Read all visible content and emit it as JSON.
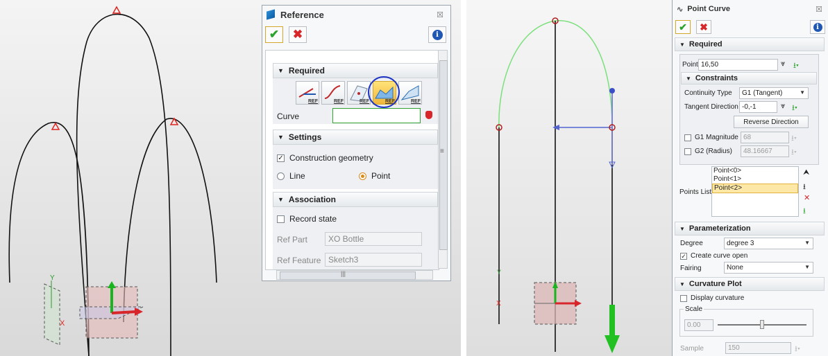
{
  "reference_panel": {
    "title": "Reference",
    "close_glyph": "☒",
    "ok_glyph": "✔",
    "cancel_glyph": "✖",
    "info_glyph": "i",
    "sections": {
      "required": {
        "label": "Required"
      },
      "settings": {
        "label": "Settings"
      },
      "association": {
        "label": "Association"
      }
    },
    "ref_icon_badge": "REF",
    "curve_label": "Curve",
    "construction_geometry": {
      "label": "Construction geometry",
      "checked": true
    },
    "mode_options": [
      {
        "label": "Line",
        "selected": false
      },
      {
        "label": "Point",
        "selected": true
      }
    ],
    "record_state": {
      "label": "Record state",
      "checked": false
    },
    "ref_part": {
      "label": "Ref Part",
      "value": "XO Bottle"
    },
    "ref_feature": {
      "label": "Ref Feature",
      "value": "Sketch3"
    },
    "scroll_grip": "|||",
    "scroll_side_grip": "≡"
  },
  "point_curve_panel": {
    "title": "Point Curve",
    "close_glyph": "☒",
    "sections": {
      "required": "Required",
      "constraints": "Constraints",
      "parameterization": "Parameterization",
      "curvature_plot": "Curvature Plot"
    },
    "point": {
      "label": "Point",
      "value": "16,50"
    },
    "continuity_type": {
      "label": "Continuity Type",
      "value": "G1 (Tangent)"
    },
    "tangent_direction": {
      "label": "Tangent Direction",
      "value": "-0,-1"
    },
    "reverse_direction": "Reverse Direction",
    "g1_magnitude": {
      "label": "G1 Magnitude",
      "value": "68"
    },
    "g2_radius": {
      "label": "G2 (Radius)",
      "value": "48.16667"
    },
    "points_list": {
      "label": "Points List",
      "items": [
        "Point<0>",
        "Point<1>",
        "Point<2>"
      ],
      "selected_index": 2
    },
    "degree": {
      "label": "Degree",
      "value": "degree 3"
    },
    "create_curve_open": {
      "label": "Create curve open",
      "checked": true
    },
    "fairing": {
      "label": "Fairing",
      "value": "None"
    },
    "display_curvature": {
      "label": "Display curvature",
      "checked": false
    },
    "scale": {
      "label": "Scale",
      "value": "0.00",
      "level": 0.5
    },
    "sample": {
      "label": "Sample",
      "value": "150"
    }
  },
  "colors": {
    "accent_blue": "#1f57b5",
    "ok_green": "#2ea12e",
    "cancel_red": "#d8252a",
    "selected_orange": "#d98b1c",
    "curve_green": "#7be07b",
    "highlight_circle": "#1f35c6"
  }
}
